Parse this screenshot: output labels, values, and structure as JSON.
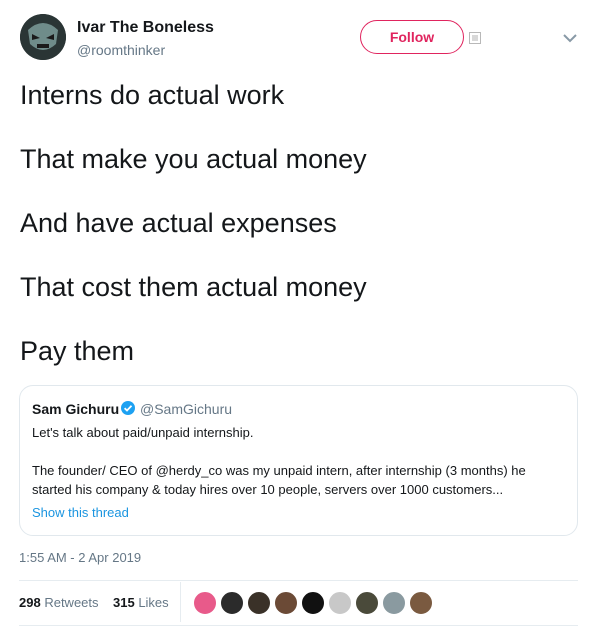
{
  "tweet": {
    "author_name": "Ivar The Boneless",
    "author_handle": "@roomthinker",
    "follow_label": "Follow",
    "lines": [
      "Interns do actual work",
      "That make you actual money",
      "And have actual expenses",
      "That cost them actual money",
      "Pay them"
    ],
    "timestamp": "1:55 AM - 2 Apr 2019",
    "retweets_count": "298",
    "retweets_label": "Retweets",
    "likes_count": "315",
    "likes_label": "Likes"
  },
  "quoted": {
    "name": "Sam Gichuru",
    "handle": "@SamGichuru",
    "line1": "Let's talk about paid/unpaid internship.",
    "line2": "The founder/ CEO of @herdy_co was my unpaid intern, after internship (3 months) he",
    "line3": "started his company & today hires over 10 people, servers over 1000 customers...",
    "show_thread": "Show this thread"
  },
  "icons": {
    "caret": "chevron-down-icon",
    "verified": "verified-badge-icon",
    "broken_image": "broken-image-icon"
  },
  "colors": {
    "follow_accent": "#e0245e",
    "link": "#1b95e0",
    "secondary_text": "#657786",
    "border": "#e1e8ed"
  },
  "liker_colors": [
    "#e85a8a",
    "#2b2b2b",
    "#3a3128",
    "#6b4a36",
    "#111111",
    "#c8c8c8",
    "#4a4a3a",
    "#8a9aa0",
    "#7a5a40"
  ]
}
